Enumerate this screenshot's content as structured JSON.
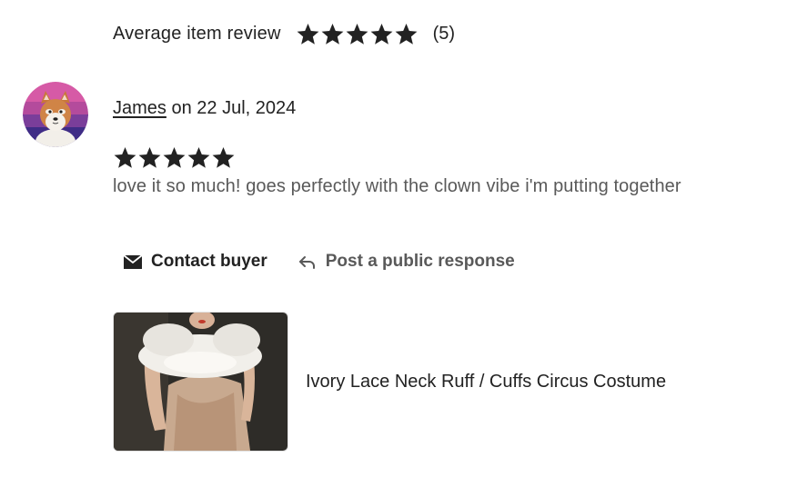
{
  "average_review": {
    "label": "Average item review",
    "stars": 5,
    "count_text": "(5)"
  },
  "review": {
    "reviewer_name": "James",
    "date_text": " on 22 Jul, 2024",
    "stars": 5,
    "text": "love it so much! goes perfectly with the clown vibe i'm putting together"
  },
  "actions": {
    "contact_label": "Contact buyer",
    "reply_label": "Post a public response"
  },
  "listing": {
    "title": "Ivory Lace Neck Ruff / Cuffs Circus Costume"
  },
  "icons": {
    "star": "star-icon",
    "contact": "envelope-icon",
    "reply": "reply-arrow-icon",
    "avatar": "shiba-dog-avatar"
  },
  "colors": {
    "text_primary": "#222222",
    "text_secondary": "#595959",
    "star": "#222222",
    "avatar_bg_top": "#c94fa0",
    "avatar_bg_bottom": "#4b2e8a"
  }
}
